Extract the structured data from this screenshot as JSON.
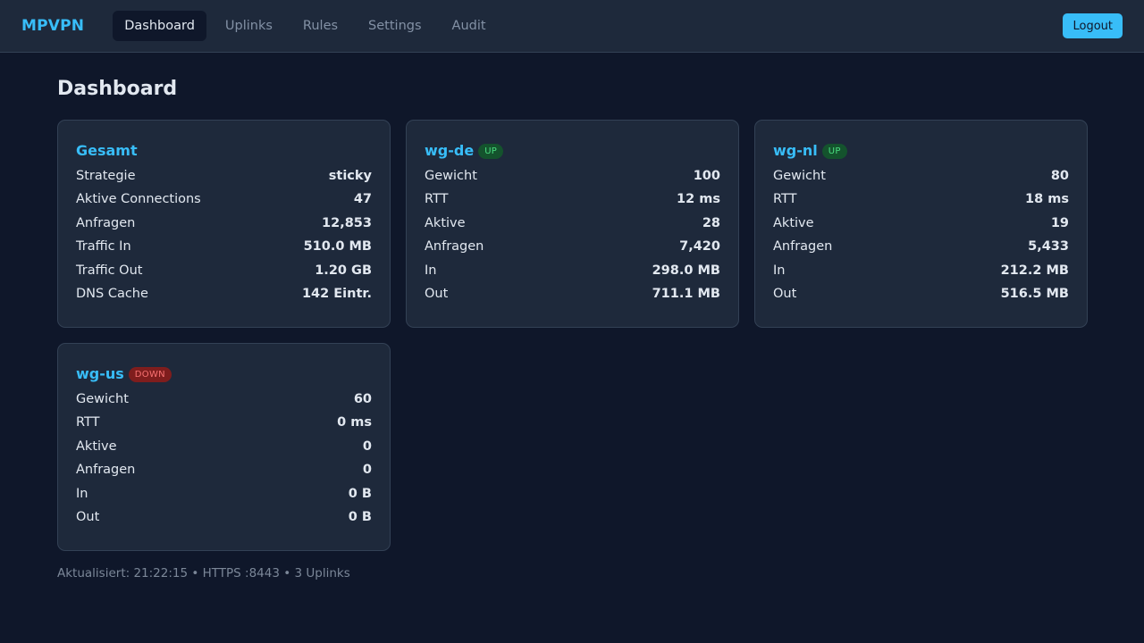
{
  "app": {
    "brand": "MPVPN"
  },
  "nav": {
    "items": [
      {
        "label": "Dashboard",
        "active": true
      },
      {
        "label": "Uplinks",
        "active": false
      },
      {
        "label": "Rules",
        "active": false
      },
      {
        "label": "Settings",
        "active": false
      },
      {
        "label": "Audit",
        "active": false
      }
    ],
    "logout_label": "Logout"
  },
  "page": {
    "title": "Dashboard"
  },
  "cards": [
    {
      "title": "Gesamt",
      "rows": [
        {
          "label": "Strategie",
          "value": "sticky"
        },
        {
          "label": "Aktive Connections",
          "value": "47"
        },
        {
          "label": "Anfragen",
          "value": "12,853"
        },
        {
          "label": "Traffic In",
          "value": "510.0 MB"
        },
        {
          "label": "Traffic Out",
          "value": "1.20 GB"
        },
        {
          "label": "DNS Cache",
          "value": "142 Eintr."
        }
      ]
    },
    {
      "title": "wg-de",
      "status": "UP",
      "rows": [
        {
          "label": "Gewicht",
          "value": "100"
        },
        {
          "label": "RTT",
          "value": "12 ms"
        },
        {
          "label": "Aktive",
          "value": "28"
        },
        {
          "label": "Anfragen",
          "value": "7,420"
        },
        {
          "label": "In",
          "value": "298.0 MB"
        },
        {
          "label": "Out",
          "value": "711.1 MB"
        }
      ]
    },
    {
      "title": "wg-nl",
      "status": "UP",
      "rows": [
        {
          "label": "Gewicht",
          "value": "80"
        },
        {
          "label": "RTT",
          "value": "18 ms"
        },
        {
          "label": "Aktive",
          "value": "19"
        },
        {
          "label": "Anfragen",
          "value": "5,433"
        },
        {
          "label": "In",
          "value": "212.2 MB"
        },
        {
          "label": "Out",
          "value": "516.5 MB"
        }
      ]
    },
    {
      "title": "wg-us",
      "status": "DOWN",
      "rows": [
        {
          "label": "Gewicht",
          "value": "60"
        },
        {
          "label": "RTT",
          "value": "0 ms"
        },
        {
          "label": "Aktive",
          "value": "0"
        },
        {
          "label": "Anfragen",
          "value": "0"
        },
        {
          "label": "In",
          "value": "0 B"
        },
        {
          "label": "Out",
          "value": "0 B"
        }
      ]
    }
  ],
  "footer": {
    "text": "Aktualisiert: 21:22:15 • HTTPS :8443 • 3 Uplinks"
  },
  "colors": {
    "background": "#0f172a",
    "surface": "#1e293b",
    "accent": "#38bdf8",
    "status_up": "#4ade80",
    "status_down": "#f87171"
  }
}
